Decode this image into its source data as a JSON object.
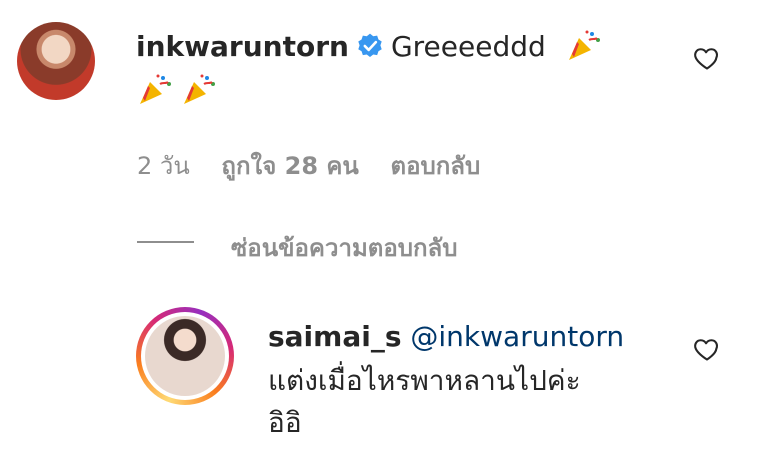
{
  "comment": {
    "username": "inkwaruntorn",
    "verified_icon": "verified-badge-icon",
    "text": "Greeeeddd",
    "emojis": [
      "party-popper",
      "party-popper",
      "party-popper"
    ],
    "time": "2 วัน",
    "likes": "ถูกใจ 28 คน",
    "reply_label": "ตอบกลับ",
    "hide_replies_label": "ซ่อนข้อความตอบกลับ"
  },
  "reply": {
    "username": "saimai_s",
    "mention": "@inkwaruntorn",
    "text_line1": "แต่งเมื่อไหรพาหลานไปค่ะ",
    "text_line2": "อิอิ"
  },
  "colors": {
    "text": "#262626",
    "muted": "#8e8e8e",
    "mention": "#00376b",
    "verified": "#3897f0"
  }
}
